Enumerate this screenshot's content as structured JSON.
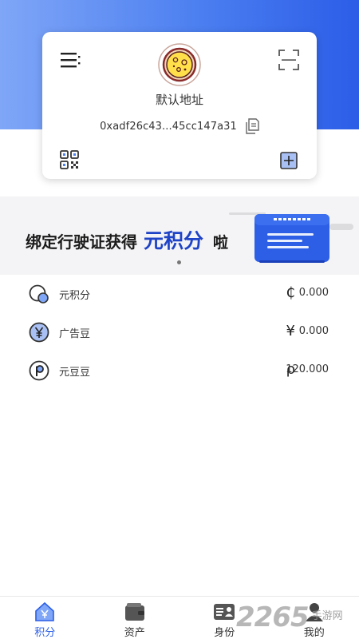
{
  "wallet_card": {
    "address_name": "默认地址",
    "address": "0xadf26c43...45cc147a31"
  },
  "banner": {
    "prefix": "绑定行驶证获得",
    "highlight": "元积分",
    "suffix": "啦",
    "page_indicator": {
      "current": 1,
      "total": 1
    }
  },
  "assets": [
    {
      "name": "元积分",
      "symbol": "₵",
      "value": "0.000",
      "icon": "yuan-points-coin-icon"
    },
    {
      "name": "广告豆",
      "symbol": "¥",
      "value": "0.000",
      "icon": "yen-coin-icon"
    },
    {
      "name": "元豆豆",
      "symbol": "ρ",
      "value": "120.000",
      "icon": "p-coin-icon"
    }
  ],
  "bottom_nav": {
    "items": [
      {
        "label": "积分",
        "icon": "home-points-icon",
        "active": true
      },
      {
        "label": "资产",
        "icon": "wallet-icon",
        "active": false
      },
      {
        "label": "身份",
        "icon": "id-card-icon",
        "active": false
      },
      {
        "label": "我的",
        "icon": "profile-icon",
        "active": false
      }
    ]
  },
  "watermark": {
    "number": "2265",
    "text": "手游网"
  },
  "colors": {
    "header_gradient_start": "#7fa6f7",
    "header_gradient_end": "#2b5de8",
    "accent": "#1f43c7",
    "nav_active": "#2c5fe6"
  }
}
